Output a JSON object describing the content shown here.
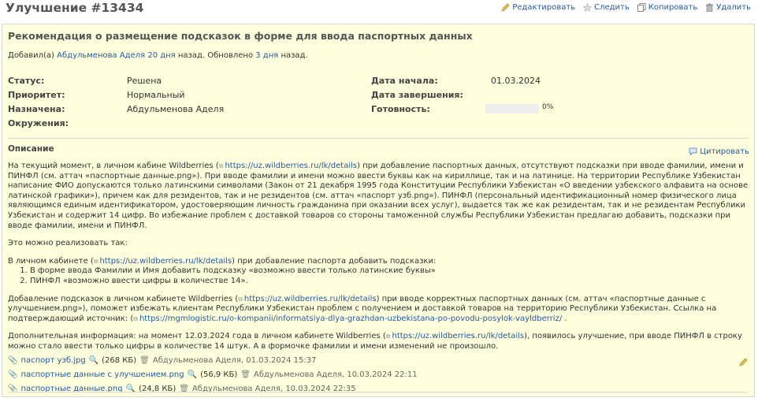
{
  "header": {
    "title": "Улучшение #13434",
    "actions": {
      "edit": "Редактировать",
      "watch": "Следить",
      "copy": "Копировать",
      "delete": "Удалить"
    }
  },
  "issue": {
    "subject": "Рекомендация о размещение подсказок в форме для ввода паспортных данных",
    "author_prefix": "Добавил(а)",
    "author": "Абдульменова Аделя",
    "created_ago": "20 дня",
    "created_suffix": "назад. Обновлено",
    "updated_ago": "3 дня",
    "updated_suffix": "назад.",
    "attributes": {
      "status_label": "Статус:",
      "status": "Решена",
      "priority_label": "Приоритет:",
      "priority": "Нормальный",
      "assigned_label": "Назначена:",
      "assigned": "Абдульменова Аделя",
      "env_label": "Окружения:",
      "start_label": "Дата начала:",
      "start": "01.03.2024",
      "due_label": "Дата завершения:",
      "done_label": "Готовность:",
      "done_ratio": 0,
      "done_text": "0%"
    },
    "description": {
      "heading": "Описание",
      "quote": "Цитировать",
      "p1_a": "На текущий момент, в личном кабине Wildberries (",
      "link_details": "https://uz.wildberries.ru/lk/details",
      "p1_b": ") при добавление паспортных данных, отсутствуют подсказки при вводе фамилии, имени и ПИНФЛ (см. аттач «паспортные данные.png»). При вводе фамилии и имени можно ввести буквы как на кириллице, так и на латинице. На территории Республике Узбекистан написание ФИО допускаются только латинскими символами (Закон от 21 декабря 1995 года Конституции Республики Узбекистан «О введении узбекского алфавита на основе латинской графики»), причем как для резидентов, так и не резидентов (см. аттач «паспорт узб.png»). ПИНФЛ (персональный идентификационный номер физического лица являющимся единым идентификатором, удостоверяющим личность гражданина при оказании всех услуг), выдается так же как резидентам, так и не резидентам Республики Узбекистан и содержит 14 цифр. Во избежание проблем с доставкой товаров со стороны таможенной службы Республики Узбекистан предлагаю добавить, подсказки при вводе фамилии, имени и ПИНФЛ.",
      "p2": "Это можно реализовать так:",
      "p3_a": "В личном кабинете (",
      "p3_b": ") при добавление паспорта добавить подсказки:",
      "li1": "В форме ввода Фамилии и Имя добавить подсказку «возможно ввести только латинские буквы»",
      "li2": "ПИНФЛ «возможно ввести цифры в количестве 14».",
      "p4_a": "Добавление подсказок в личном кабинете Wildberries (",
      "p4_b": ") при вводе корректных паспортных данных (см. аттач «паспортные данные с улучшением.png»), поможет избежать клиентам Республики Узбекистан проблем с получением и доставкой товаров на территорию Республики Узбекистан. Ссылка на подтверждающий источник: (",
      "link_source": "https://mgmlogistic.ru/o-kompanii/informatsiya-dlya-grazhdan-uzbekistana-po-povodu-posylok-vayldberriz/",
      "p4_c": ".",
      "p5_a": "Дополнительная информация: на момент 12.03.2024 года в личном кабинете Wildberries (",
      "p5_b": "), появилось улучшение, при вводе ПИНФЛ в строку можно стало ввести только цифры в количестве 14 штук. А в формочке фамилии и имени изменений не произошло."
    },
    "attachments": [
      {
        "name": "паспорт узб.jpg",
        "size": "(268 КБ)",
        "meta": "Абдульменова Аделя, 01.03.2024 15:37"
      },
      {
        "name": "паспортные данные с улучшением.png",
        "size": "(56,9 КБ)",
        "meta": "Абдульменова Аделя, 10.03.2024 22:11"
      },
      {
        "name": "паспортные данные.png",
        "size": "(24,8 КБ)",
        "meta": "Абдульменова Аделя, 10.03.2024 22:35"
      }
    ]
  }
}
